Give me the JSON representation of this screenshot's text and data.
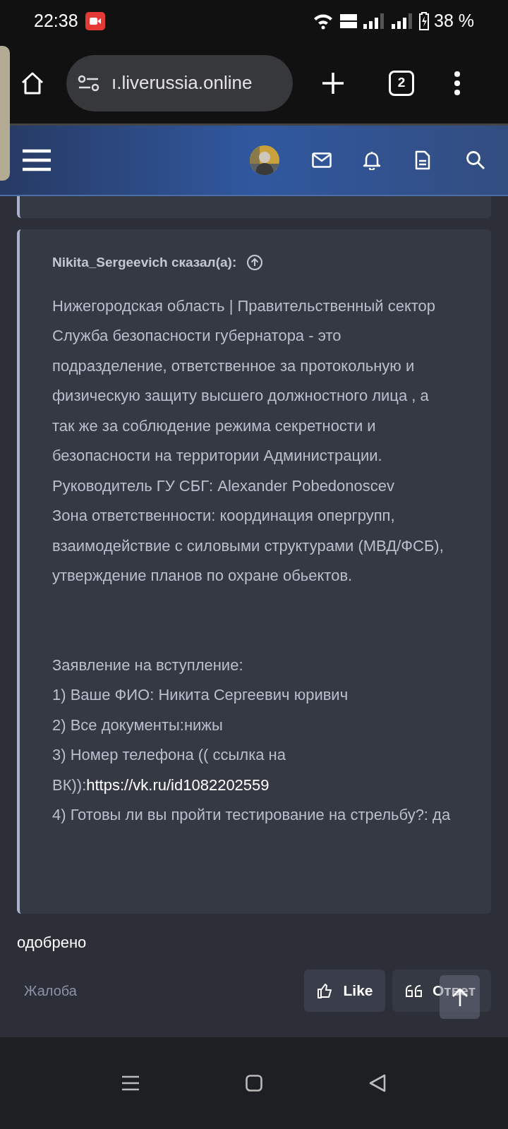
{
  "status_bar": {
    "time": "22:38",
    "battery": "38 %"
  },
  "browser": {
    "url": "ı.liverussia.online",
    "tab_count": "2"
  },
  "quote": {
    "author": "Nikita_Sergeevich сказал(а):",
    "blocks": [
      {
        "lines": [
          {
            "text": "Нижегородская область | Правительственный сектор"
          },
          {
            "text": "Служба безопасности губернатора - это подразделение, ответственное за протокольную и физическую защиту высшего должностного лица , а так же за соблюдение режима секретности и безопасности на территории Администрации."
          },
          {
            "text": "Руководитель ГУ СБГ: Alexander Pobedonoscev"
          },
          {
            "text": "Зона ответственности: координация опергрупп, взаимодействие с силовыми структурами (МВД/ФСБ), утверждение планов по охране обьектов."
          }
        ]
      },
      {
        "lines": [
          {
            "text": "Заявление на вступление:"
          },
          {
            "text": "1) Ваше ФИО: Никита Сергеевич юривич"
          },
          {
            "text": "2) Все документы:нижы"
          },
          {
            "text": "3) Номер телефона (( ссылка на ВК)):",
            "link": "https://vk.ru/id1082202559"
          },
          {
            "text": "4) Готовы ли вы пройти тестирование на стрельбу?: да"
          }
        ]
      }
    ]
  },
  "reply": "одобрено",
  "actions": {
    "report": "Жалоба",
    "like": "Like",
    "answer": "Ответ"
  }
}
